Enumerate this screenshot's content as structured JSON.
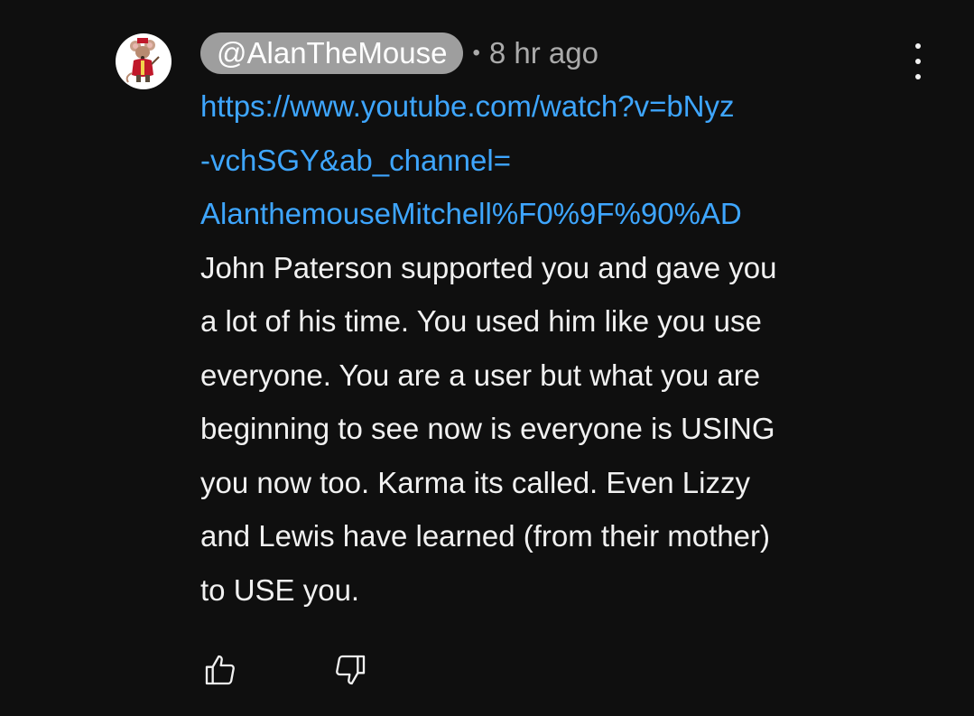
{
  "comment": {
    "author": "@AlanTheMouse",
    "separator": "•",
    "timestamp": "8 hr ago",
    "link_lines": [
      "https://www.youtube.com/watch?v=bNyz",
      "-vchSGY&ab_channel=",
      "AlanthemouseMitchell%F0%9F%90%AD"
    ],
    "text_lines": [
      "John Paterson supported you and gave you",
      "a lot of his time. You used him like you use",
      "everyone. You are a user but what you are",
      "beginning to see now is everyone is USING",
      "you now too. Karma its called. Even Lizzy",
      "and Lewis have learned (from their mother)",
      "to USE you."
    ]
  },
  "icons": {
    "avatar": "mouse-character-avatar",
    "menu": "more-vert-icon",
    "like": "thumb-up-icon",
    "dislike": "thumb-down-icon"
  },
  "colors": {
    "background": "#0f0f0f",
    "link": "#3ea6ff",
    "text": "#f1f1f1",
    "muted": "#aaaaaa",
    "author_chip": "#9e9e9e"
  }
}
